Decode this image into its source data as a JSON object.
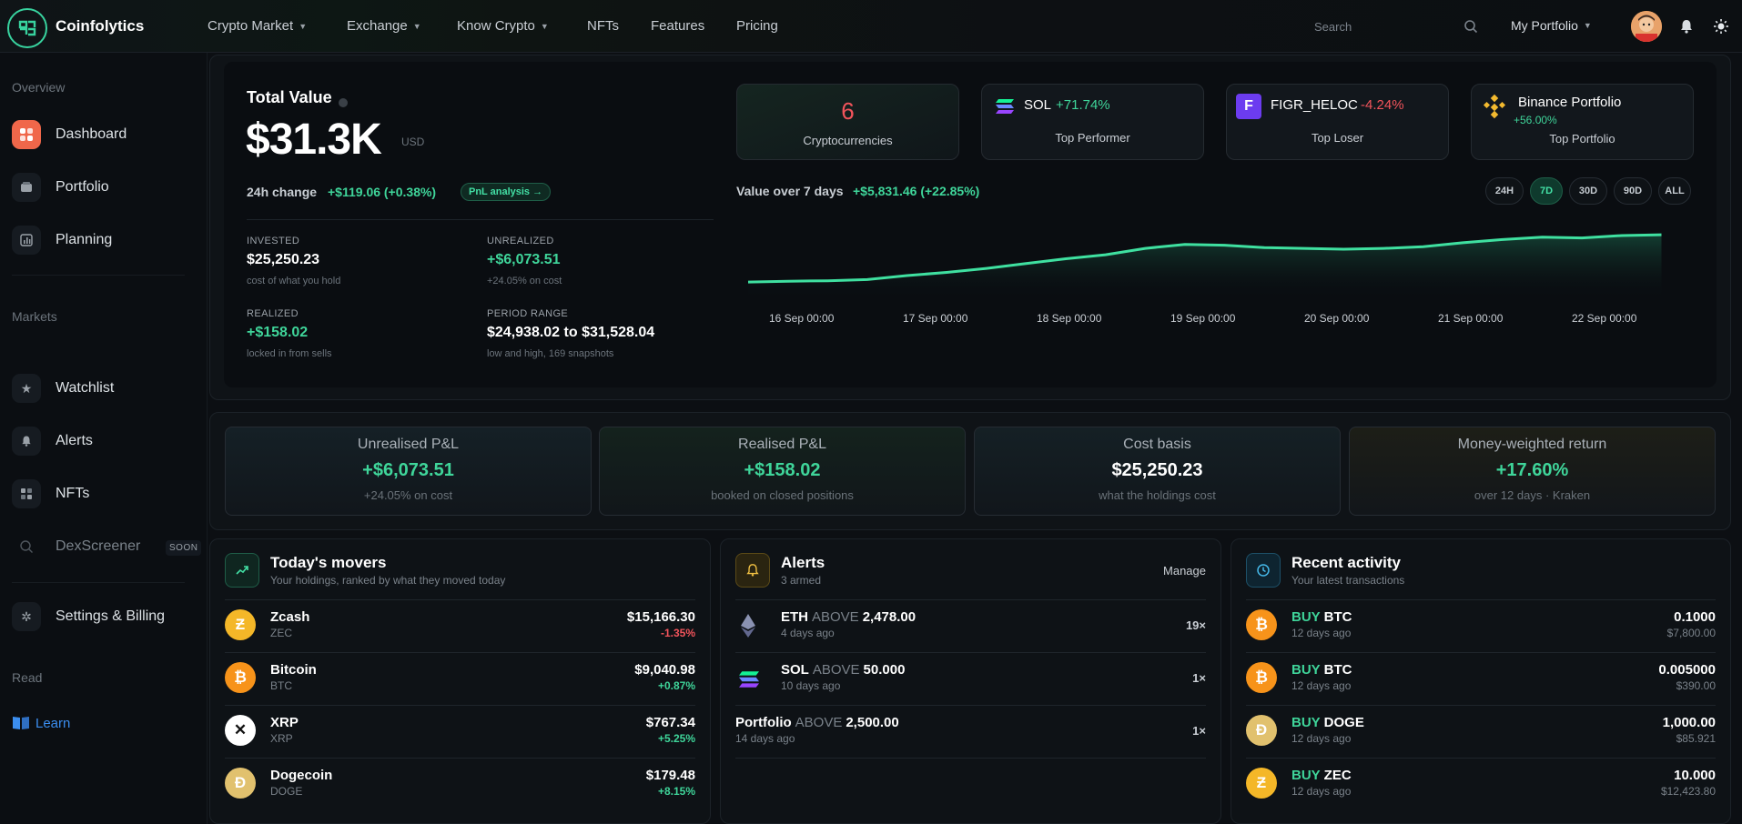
{
  "nav": {
    "brand": "Coinfolytics",
    "items": [
      {
        "label": "Crypto Market",
        "dropdown": true
      },
      {
        "label": "Exchange",
        "dropdown": true
      },
      {
        "label": "Know Crypto",
        "dropdown": true
      },
      {
        "label": "NFTs",
        "dropdown": false
      },
      {
        "label": "Features",
        "dropdown": false
      },
      {
        "label": "Pricing",
        "dropdown": false
      }
    ],
    "search_placeholder": "Search",
    "my_portfolio": "My Portfolio"
  },
  "sidebar": {
    "sections": {
      "overview": "Overview",
      "markets": "Markets",
      "read": "Read"
    },
    "overview_items": [
      {
        "label": "Dashboard",
        "icon": "dashboard-icon",
        "active": true
      },
      {
        "label": "Portfolio",
        "icon": "wallet-icon"
      },
      {
        "label": "Planning",
        "icon": "chart-icon"
      }
    ],
    "market_items": [
      {
        "label": "Watchlist",
        "icon": "star-icon"
      },
      {
        "label": "Alerts",
        "icon": "bell-icon"
      },
      {
        "label": "NFTs",
        "icon": "grid-icon"
      },
      {
        "label": "DexScreener",
        "icon": "search-icon",
        "badge": "SOON"
      }
    ],
    "settings": "Settings & Billing",
    "learn": "Learn"
  },
  "summary": {
    "total_value_label": "Total Value",
    "total_value": "$31.3K",
    "currency": "USD",
    "change_label": "24h change",
    "change_value": "+$119.06 (+0.38%)",
    "pnl_button": "PnL analysis →",
    "metrics": [
      {
        "label": "INVESTED",
        "value": "$25,250.23",
        "sub": "cost of what you hold",
        "tone": "white"
      },
      {
        "label": "UNREALIZED",
        "value": "+$6,073.51",
        "sub": "+24.05% on cost",
        "tone": "green"
      },
      {
        "label": "REALIZED",
        "value": "+$158.02",
        "sub": "locked in from sells",
        "tone": "green"
      },
      {
        "label": "PERIOD RANGE",
        "value": "$24,938.02 to $31,528.04",
        "sub": "low and high, 169 snapshots",
        "tone": "white"
      }
    ]
  },
  "top_cards": {
    "crypto_count": "6",
    "crypto_label": "Cryptocurrencies",
    "top_performer": {
      "name": "SOL",
      "change": "+71.74%",
      "label": "Top Performer"
    },
    "top_loser": {
      "name": "FIGR_HELOC",
      "change": "-4.24%",
      "label": "Top Loser"
    },
    "top_portfolio": {
      "name": "Binance Portfolio",
      "change": "+56.00%",
      "label": "Top Portfolio"
    }
  },
  "chart_header": {
    "label": "Value over 7 days",
    "change": "+$5,831.46 (+22.85%)",
    "ranges": [
      "24H",
      "7D",
      "30D",
      "90D",
      "ALL"
    ],
    "active_range": "7D"
  },
  "chart_data": {
    "type": "area",
    "x_ticks": [
      "16 Sep 00:00",
      "17 Sep 00:00",
      "18 Sep 00:00",
      "19 Sep 00:00",
      "20 Sep 00:00",
      "21 Sep 00:00",
      "22 Sep 00:00"
    ],
    "x": [
      0,
      0.3,
      0.6,
      0.9,
      1.2,
      1.5,
      1.8,
      2.1,
      2.4,
      2.7,
      3.0,
      3.3,
      3.6,
      3.9,
      4.2,
      4.5,
      4.8,
      5.1,
      5.4,
      5.7,
      6.0,
      6.3,
      6.6,
      6.9
    ],
    "values": [
      25500,
      25600,
      25650,
      25800,
      26300,
      26700,
      27200,
      27800,
      28400,
      28900,
      29700,
      30200,
      30100,
      29800,
      29700,
      29600,
      29700,
      29900,
      30400,
      30800,
      31100,
      31000,
      31300,
      31400
    ],
    "ylim": [
      24938.02,
      31528.04
    ],
    "color": "#3fe0a0",
    "grid": false
  },
  "stats": [
    {
      "title": "Unrealised P&L",
      "value": "+$6,073.51",
      "sub": "+24.05% on cost",
      "tone": "green"
    },
    {
      "title": "Realised P&L",
      "value": "+$158.02",
      "sub": "booked on closed positions",
      "tone": "green"
    },
    {
      "title": "Cost basis",
      "value": "$25,250.23",
      "sub": "what the holdings cost",
      "tone": "white"
    },
    {
      "title": "Money-weighted return",
      "value": "+17.60%",
      "sub": "over 12 days · Kraken",
      "tone": "green"
    }
  ],
  "movers": {
    "title": "Today's movers",
    "subtitle": "Your holdings, ranked by what they moved today",
    "rows": [
      {
        "name": "Zcash",
        "symbol": "ZEC",
        "value": "$15,166.30",
        "change": "-1.35%",
        "tone": "red",
        "icon": "zcash-icon",
        "color": "#f4b728",
        "glyph": "Ƶ"
      },
      {
        "name": "Bitcoin",
        "symbol": "BTC",
        "value": "$9,040.98",
        "change": "+0.87%",
        "tone": "green",
        "icon": "bitcoin-icon",
        "color": "#f7931a",
        "glyph": "₿"
      },
      {
        "name": "XRP",
        "symbol": "XRP",
        "value": "$767.34",
        "change": "+5.25%",
        "tone": "green",
        "icon": "xrp-icon",
        "color": "#ffffff",
        "glyph": "✕"
      },
      {
        "name": "Dogecoin",
        "symbol": "DOGE",
        "value": "$179.48",
        "change": "+8.15%",
        "tone": "green",
        "icon": "dogecoin-icon",
        "color": "#e1c16e",
        "glyph": "Ð"
      }
    ]
  },
  "alerts": {
    "title": "Alerts",
    "subtitle": "3 armed",
    "manage": "Manage",
    "rows": [
      {
        "asset": "ETH",
        "condition": "ABOVE",
        "target": "2,478.00",
        "time": "4 days ago",
        "count": "19×",
        "icon": "ethereum-icon"
      },
      {
        "asset": "SOL",
        "condition": "ABOVE",
        "target": "50.000",
        "time": "10 days ago",
        "count": "1×",
        "icon": "solana-icon"
      },
      {
        "asset": "Portfolio",
        "condition": "ABOVE",
        "target": "2,500.00",
        "time": "14 days ago",
        "count": "1×",
        "icon": ""
      }
    ]
  },
  "activity": {
    "title": "Recent activity",
    "subtitle": "Your latest transactions",
    "rows": [
      {
        "action": "BUY",
        "asset": "BTC",
        "time": "12 days ago",
        "qty": "0.1000",
        "value": "$7,800.00",
        "icon": "bitcoin-icon",
        "color": "#f7931a",
        "glyph": "₿"
      },
      {
        "action": "BUY",
        "asset": "BTC",
        "time": "12 days ago",
        "qty": "0.005000",
        "value": "$390.00",
        "icon": "bitcoin-icon",
        "color": "#f7931a",
        "glyph": "₿"
      },
      {
        "action": "BUY",
        "asset": "DOGE",
        "time": "12 days ago",
        "qty": "1,000.00",
        "value": "$85.921",
        "icon": "dogecoin-icon",
        "color": "#e1c16e",
        "glyph": "Ð"
      },
      {
        "action": "BUY",
        "asset": "ZEC",
        "time": "12 days ago",
        "qty": "10.000",
        "value": "$12,423.80",
        "icon": "zcash-icon",
        "color": "#f4b728",
        "glyph": "Ƶ"
      }
    ]
  }
}
